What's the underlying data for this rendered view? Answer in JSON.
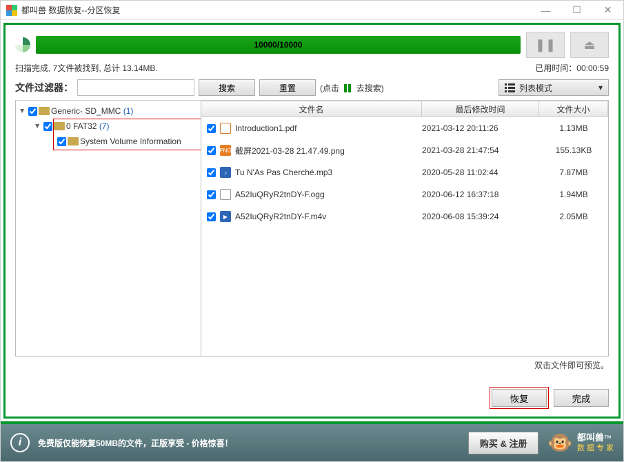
{
  "window": {
    "title": "都叫兽 数据恢复--分区恢复"
  },
  "progress": {
    "text": "10000/10000"
  },
  "status": {
    "summary": "扫描完成,  7文件被找到, 总计 13.14MB.",
    "elapsed_label": "已用时间：",
    "elapsed_value": "00:00:59"
  },
  "filter": {
    "label": "文件过滤器：",
    "search_btn": "搜索",
    "reset_btn": "重置",
    "hint_prefix": "(点击",
    "hint_suffix": "去搜索)",
    "view_mode": "列表模式"
  },
  "columns": {
    "name": "文件名",
    "date": "最后修改时间",
    "size": "文件大小"
  },
  "tree": {
    "root": {
      "label": "Generic- SD_MMC",
      "count": "(1)"
    },
    "child": {
      "label": "0 FAT32",
      "count": "(7)"
    },
    "leaf": {
      "label": "System Volume Information"
    }
  },
  "files": [
    {
      "icon": "pdf",
      "name": "Introduction1.pdf",
      "date": "2021-03-12 20:11:26",
      "size": "1.13MB"
    },
    {
      "icon": "png",
      "name": "截屏2021-03-28 21.47.49.png",
      "date": "2021-03-28 21:47:54",
      "size": "155.13KB"
    },
    {
      "icon": "mp3",
      "name": "Tu N'As Pas Cherché.mp3",
      "date": "2020-05-28 11:02:44",
      "size": "7.87MB"
    },
    {
      "icon": "txt",
      "name": "A52IuQRyR2tnDY-F.ogg",
      "date": "2020-06-12 16:37:18",
      "size": "1.94MB"
    },
    {
      "icon": "m4v",
      "name": "A52IuQRyR2tnDY-F.m4v",
      "date": "2020-06-08 15:39:24",
      "size": "2.05MB"
    }
  ],
  "hint": "双击文件即可预览。",
  "actions": {
    "recover": "恢复",
    "done": "完成"
  },
  "footer": {
    "message": "免费版仅能恢复50MB的文件，正版享受 - 价格惊喜！",
    "buy": "购买 & 注册",
    "brand_top": "都叫兽",
    "brand_sub": "数 据 专 家"
  }
}
